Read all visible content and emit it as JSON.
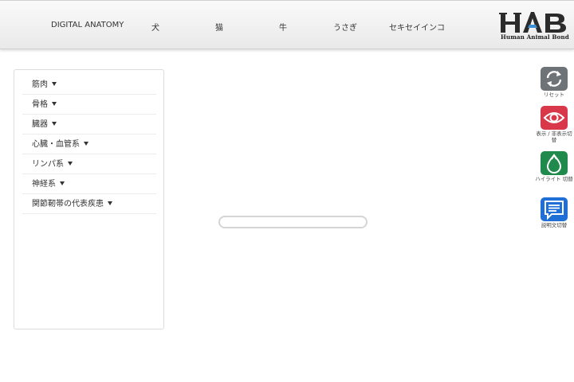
{
  "header": {
    "nav": [
      {
        "id": "brand",
        "label": "DIGITAL ANATOMY"
      },
      {
        "id": "dog",
        "label": "犬"
      },
      {
        "id": "cat",
        "label": "猫"
      },
      {
        "id": "cow",
        "label": "牛"
      },
      {
        "id": "rabbit",
        "label": "うさぎ"
      },
      {
        "id": "budgie",
        "label": "セキセイインコ"
      }
    ],
    "logo": {
      "mark": "HAB",
      "text": "Human Animal Bond"
    }
  },
  "sidebar": {
    "items": [
      {
        "label": "筋肉"
      },
      {
        "label": "骨格"
      },
      {
        "label": "臓器"
      },
      {
        "label": "心臓・血管系"
      },
      {
        "label": "リンパ系"
      },
      {
        "label": "神経系"
      },
      {
        "label": "関節靭帯の代表疾患"
      }
    ]
  },
  "loading": {
    "progress": 0.0
  },
  "tools": [
    {
      "id": "reset",
      "label": "リセット",
      "color": "#6e7378",
      "icon": "refresh-icon"
    },
    {
      "id": "toggle",
      "label": "表示 / 非表示切替",
      "color": "#d9374a",
      "icon": "eye-icon"
    },
    {
      "id": "highlight",
      "label": "ハイライト 切替",
      "color": "#1f8a4c",
      "icon": "highlight-icon"
    },
    {
      "id": "desc",
      "label": "説明文切替",
      "color": "#1f6fd6",
      "icon": "speech-bubble-icon"
    }
  ]
}
